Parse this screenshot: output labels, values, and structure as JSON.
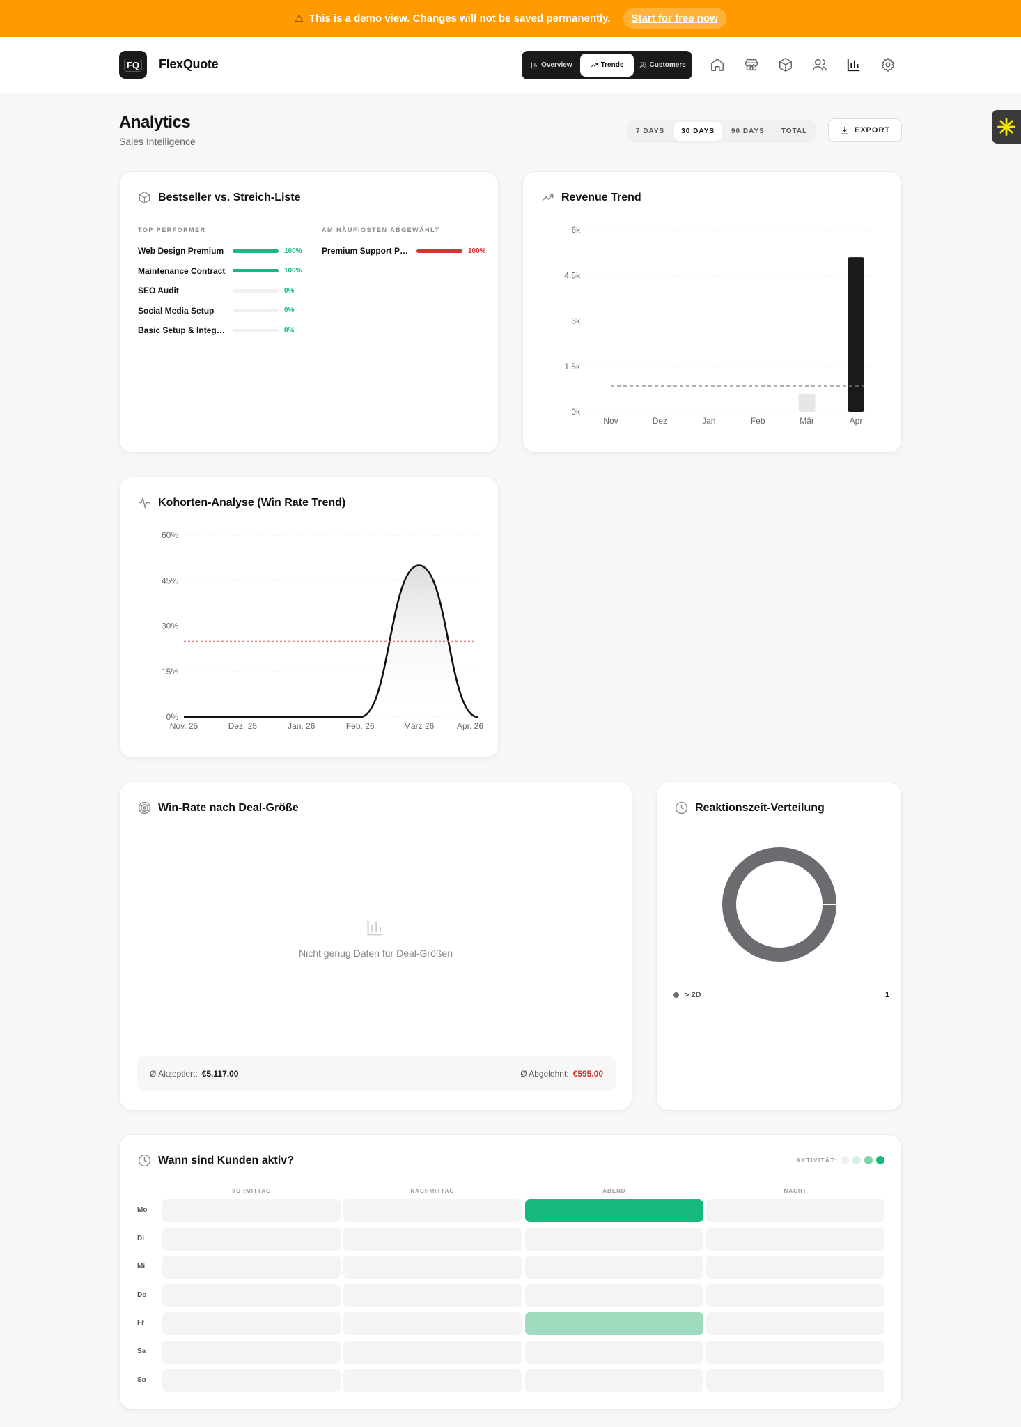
{
  "banner": {
    "text": "This is a demo view. Changes will not be saved permanently.",
    "cta": "Start for free now",
    "color": "#ff9a00"
  },
  "header": {
    "logo_text": "FQ",
    "brand": "FlexQuote",
    "segments": [
      {
        "label": "Overview",
        "icon": "bar-chart-icon",
        "active": false
      },
      {
        "label": "Trends",
        "icon": "trending-up-icon",
        "active": true
      },
      {
        "label": "Customers",
        "icon": "users-icon",
        "active": false
      }
    ],
    "nav_icons": [
      "home-icon",
      "store-icon",
      "box-icon",
      "users-icon",
      "bar-chart-icon",
      "gear-icon"
    ],
    "active_nav": "bar-chart-icon"
  },
  "page": {
    "title": "Analytics",
    "subtitle": "Sales Intelligence",
    "ranges": [
      {
        "label": "7 DAYS",
        "active": false
      },
      {
        "label": "30 DAYS",
        "active": true
      },
      {
        "label": "90 DAYS",
        "active": false
      },
      {
        "label": "TOTAL",
        "active": false
      }
    ],
    "export_label": "EXPORT"
  },
  "bestseller": {
    "title": "Bestseller vs. Streich-Liste",
    "top_heading": "TOP PERFORMER",
    "deselected_heading": "AM HÄUFIGSTEN ABGEWÄHLT",
    "top": [
      {
        "name": "Web Design Premium",
        "value": "100%",
        "fraction": 1.0
      },
      {
        "name": "Maintenance Contract",
        "value": "100%",
        "fraction": 1.0
      },
      {
        "name": "SEO Audit",
        "value": "0%",
        "fraction": 0
      },
      {
        "name": "Social Media Setup",
        "value": "0%",
        "fraction": 0
      },
      {
        "name": "Basic Setup & Integration",
        "value": "0%",
        "fraction": 0
      }
    ],
    "deselected": [
      {
        "name": "Premium Support Package",
        "value": "100%",
        "fraction": 1.0
      }
    ],
    "colors": {
      "positive": "#16b97e",
      "negative": "#d93030"
    }
  },
  "revenue": {
    "title": "Revenue Trend"
  },
  "cohort": {
    "title": "Kohorten-Analyse (Win Rate Trend)"
  },
  "chart_data": [
    {
      "type": "bar",
      "title": "Revenue Trend",
      "categories": [
        "Nov",
        "Dez",
        "Jan",
        "Feb",
        "Mär",
        "Apr"
      ],
      "values": [
        0,
        0,
        0,
        0,
        600,
        5100
      ],
      "y_ticks": [
        "0k",
        "1.5k",
        "3k",
        "4.5k",
        "6k"
      ],
      "ylim": [
        0,
        6000
      ],
      "average_line": 850,
      "grid": true
    },
    {
      "type": "line",
      "title": "Kohorten-Analyse (Win Rate Trend)",
      "x": [
        "Nov. 25",
        "Dez. 25",
        "Jan. 26",
        "Feb. 26",
        "März 26",
        "Apr. 26"
      ],
      "values": [
        0,
        0,
        0,
        0,
        50,
        0
      ],
      "y_ticks": [
        "0%",
        "15%",
        "30%",
        "45%",
        "60%"
      ],
      "ylim": [
        0,
        60
      ],
      "average_line": 25,
      "grid": true
    },
    {
      "type": "pie",
      "title": "Reaktionszeit-Verteilung",
      "slices": [
        {
          "label": "> 2D",
          "value": 1
        }
      ]
    }
  ],
  "winrate": {
    "title": "Win-Rate nach Deal-Größe",
    "empty_message": "Nicht genug Daten für Deal-Größen",
    "accepted_label": "Ø Akzeptiert:",
    "accepted_value": "€5,117.00",
    "rejected_label": "Ø Abgelehnt:",
    "rejected_value": "€595.00"
  },
  "reaction": {
    "title": "Reaktionszeit-Verteilung",
    "legend_label": "> 2D",
    "legend_count": "1"
  },
  "activity": {
    "title": "Wann sind Kunden aktiv?",
    "legend_label": "AKTIVITÄT:",
    "columns": [
      "VORMITTAG",
      "NACHMITTAG",
      "ABEND",
      "NACHT"
    ],
    "days": [
      "Mo",
      "Di",
      "Mi",
      "Do",
      "Fr",
      "Sa",
      "So"
    ],
    "levels": [
      [
        0,
        0,
        1,
        0
      ],
      [
        0,
        0,
        0,
        0
      ],
      [
        0,
        0,
        0,
        0
      ],
      [
        0,
        0,
        0,
        0
      ],
      [
        0,
        0,
        0.4,
        0
      ],
      [
        0,
        0,
        0,
        0
      ],
      [
        0,
        0,
        0,
        0
      ]
    ],
    "colors": {
      "high": "#16b97e",
      "mid": "#9fdcbf",
      "empty": "#f4f4f4"
    }
  }
}
